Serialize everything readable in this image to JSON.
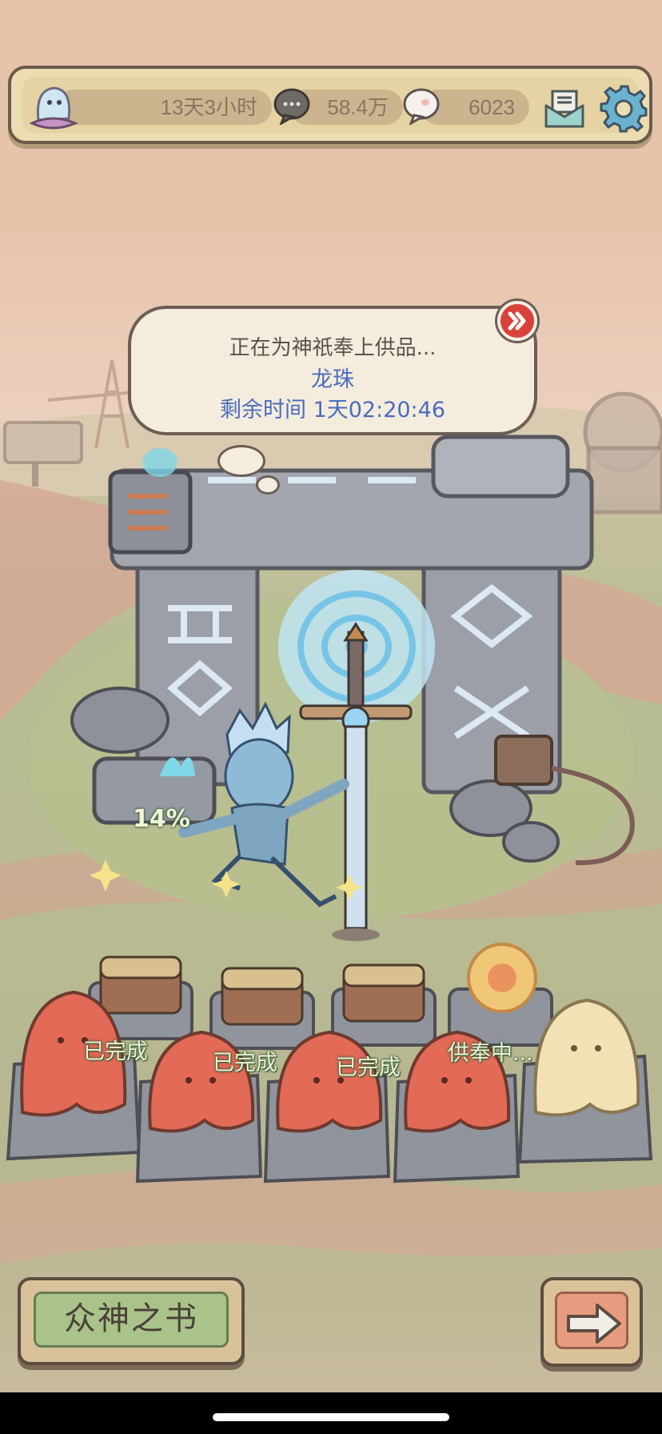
{
  "hud": {
    "timer": "13天3小时",
    "coins": "58.4万",
    "gems": "6023"
  },
  "bubble": {
    "status": "正在为神祇奉上供品...",
    "item": "龙珠",
    "remaining": "剩余时间  1天02:20:46"
  },
  "altar": {
    "progress": "14%"
  },
  "slots": [
    {
      "status": "已完成"
    },
    {
      "status": "已完成"
    },
    {
      "status": "已完成"
    },
    {
      "status": "供奉中..."
    }
  ],
  "buttons": {
    "book_label": "众神之书"
  },
  "colors": {
    "accent_blue": "#4a6cc0",
    "skip_red": "#d9423a",
    "ghost_red": "#e26a56",
    "ghost_cream": "#f1e2b6",
    "hud_bg": "#ecdcb1"
  },
  "icons": [
    "ghost-avatar-icon",
    "chat-bubble-icon",
    "chat-bubble-white-icon",
    "mail-icon",
    "gear-icon",
    "fast-forward-icon",
    "arrow-right-icon"
  ]
}
